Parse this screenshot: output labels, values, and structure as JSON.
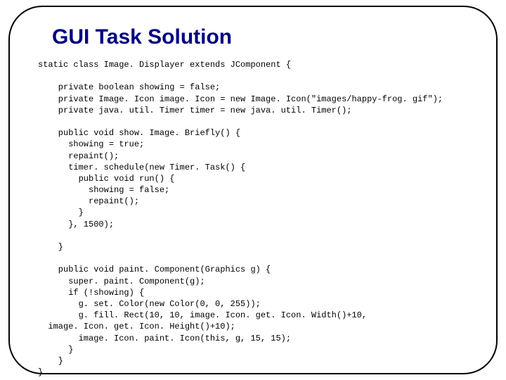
{
  "slide": {
    "title": "GUI Task Solution",
    "code_lines": [
      "static class Image. Displayer extends JComponent {",
      "",
      "    private boolean showing = false;",
      "    private Image. Icon image. Icon = new Image. Icon(\"images/happy-frog. gif\");",
      "    private java. util. Timer timer = new java. util. Timer();",
      "",
      "    public void show. Image. Briefly() {",
      "      showing = true;",
      "      repaint();",
      "      timer. schedule(new Timer. Task() {",
      "        public void run() {",
      "          showing = false;",
      "          repaint();",
      "        }",
      "      }, 1500);",
      "",
      "    }",
      "",
      "    public void paint. Component(Graphics g) {",
      "      super. paint. Component(g);",
      "      if (!showing) {",
      "        g. set. Color(new Color(0, 0, 255));",
      "        g. fill. Rect(10, 10, image. Icon. get. Icon. Width()+10,",
      "  image. Icon. get. Icon. Height()+10);",
      "        image. Icon. paint. Icon(this, g, 15, 15);",
      "      }",
      "    }",
      "}"
    ]
  }
}
